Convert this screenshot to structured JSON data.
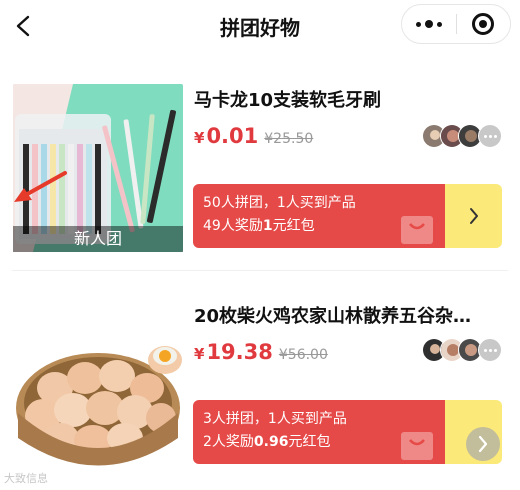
{
  "header": {
    "title": "拼团好物",
    "back_icon": "chevron-left-icon",
    "more_icon": "more-dots-icon",
    "close_icon": "target-circle-icon"
  },
  "products": [
    {
      "name": "马卡龙10支装软毛牙刷",
      "currency": "¥",
      "price": "0.01",
      "original_price": "¥25.50",
      "badge": "新人团",
      "group_line1": "50人拼团，1人买到产品",
      "group_line2_prefix": "49人奖励",
      "group_line2_amount": "1",
      "group_line2_suffix": "元红包",
      "image": "toothbrush-pack-image"
    },
    {
      "name": "20枚柴火鸡农家山林散养五谷杂…",
      "currency": "¥",
      "price": "19.38",
      "original_price": "¥56.00",
      "group_line1": "3人拼团，1人买到产品",
      "group_line2_prefix": "2人奖励",
      "group_line2_amount": "0.96",
      "group_line2_suffix": "元红包",
      "image": "eggs-basket-image"
    }
  ],
  "watermark": "大致信息",
  "colors": {
    "price_red": "#e0393e",
    "group_red": "#e64a48",
    "group_yellow": "#fbe979"
  }
}
